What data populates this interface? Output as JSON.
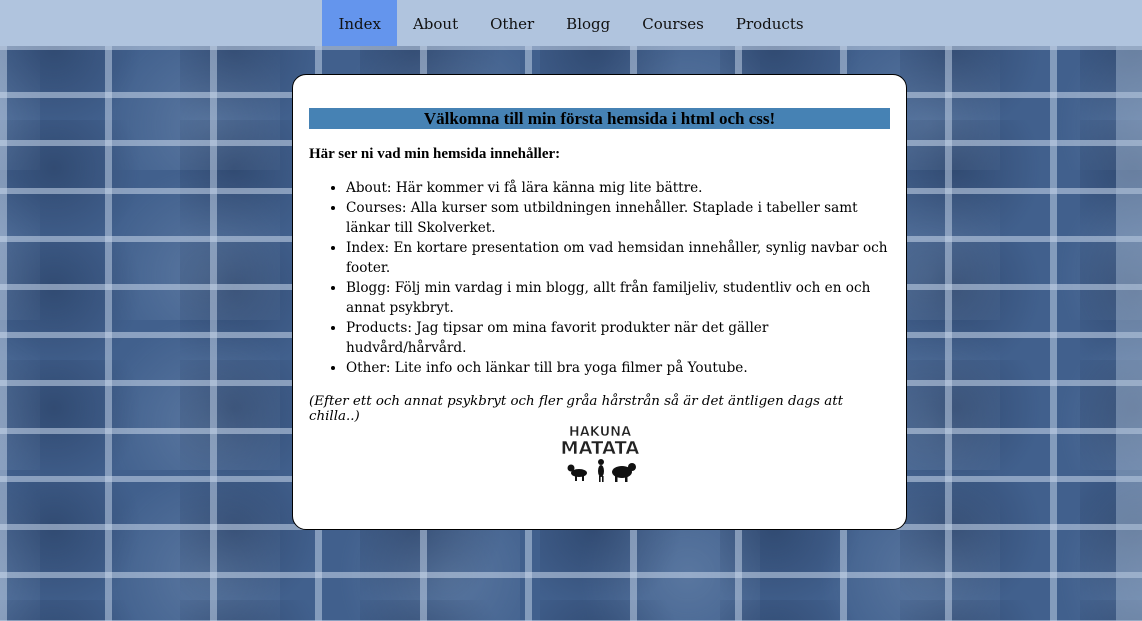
{
  "nav": {
    "items": [
      {
        "label": "Index",
        "active": true
      },
      {
        "label": "About",
        "active": false
      },
      {
        "label": "Other",
        "active": false
      },
      {
        "label": "Blogg",
        "active": false
      },
      {
        "label": "Courses",
        "active": false
      },
      {
        "label": "Products",
        "active": false
      }
    ]
  },
  "main": {
    "heading": "Välkomna till min första hemsida i html och css!",
    "intro": "Här ser ni vad min hemsida innehåller:",
    "list": [
      "About: Här kommer vi få lära känna mig lite bättre.",
      "Courses: Alla kurser som utbildningen innehåller. Staplade i tabeller samt länkar till Skolverket.",
      "Index: En kortare presentation om vad hemsidan innehåller, synlig navbar och footer.",
      "Blogg: Följ min vardag i min blogg, allt från familjeliv, studentliv och en och annat psykbryt.",
      "Products: Jag tipsar om mina favorit produkter när det gäller hudvård/hårvård.",
      "Other: Lite info och länkar till bra yoga filmer på Youtube."
    ],
    "footnote": "(Efter ett och annat psykbryt och fler gråa hårstrån så är det äntligen dags att chilla..)",
    "logo_text": [
      "HAKUNA",
      "MATATA"
    ]
  },
  "colors": {
    "navbar": "#b0c4de",
    "nav_active": "#6495ed",
    "heading_bar": "#4682b4",
    "wall": "#41608d"
  }
}
